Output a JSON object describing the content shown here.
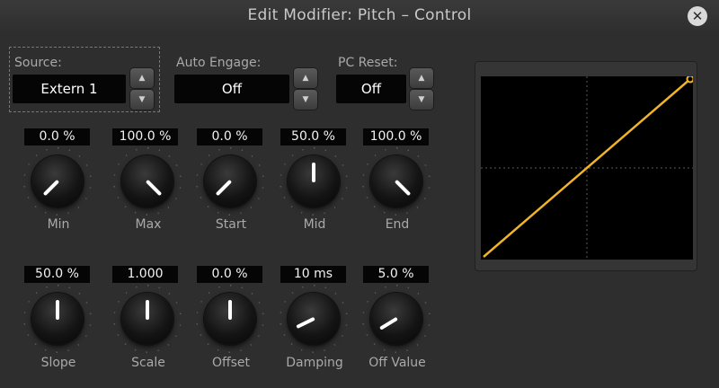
{
  "window": {
    "title": "Edit Modifier: Pitch – Control",
    "close_glyph": "✕"
  },
  "source": {
    "label": "Source:",
    "value": "Extern 1"
  },
  "auto_engage": {
    "label": "Auto Engage:",
    "value": "Off"
  },
  "pc_reset": {
    "label": "PC Reset:",
    "value": "Off"
  },
  "spin": {
    "up": "▲",
    "down": "▼"
  },
  "knobs_row1": [
    {
      "label": "Min",
      "value": "0.0 %",
      "level": 0.0
    },
    {
      "label": "Max",
      "value": "100.0 %",
      "level": 1.0
    },
    {
      "label": "Start",
      "value": "0.0 %",
      "level": 0.0
    },
    {
      "label": "Mid",
      "value": "50.0 %",
      "level": 0.5
    },
    {
      "label": "End",
      "value": "100.0 %",
      "level": 1.0
    }
  ],
  "knobs_row2": [
    {
      "label": "Slope",
      "value": "50.0 %",
      "level": 0.5
    },
    {
      "label": "Scale",
      "value": "1.000",
      "level": 0.5
    },
    {
      "label": "Offset",
      "value": "0.0 %",
      "level": 0.5
    },
    {
      "label": "Damping",
      "value": "10 ms",
      "level": 0.07
    },
    {
      "label": "Off Value",
      "value": "5.0 %",
      "level": 0.05
    }
  ],
  "curve": {
    "input_range": [
      0,
      1
    ],
    "output_range": [
      0,
      1
    ],
    "points": [
      [
        0,
        0
      ],
      [
        1,
        1
      ]
    ]
  },
  "colors": {
    "curve": "#f0b429",
    "grid": "#5a5a5a"
  },
  "icons": {
    "close": "close-icon",
    "up": "up-arrow-icon",
    "down": "down-arrow-icon"
  }
}
